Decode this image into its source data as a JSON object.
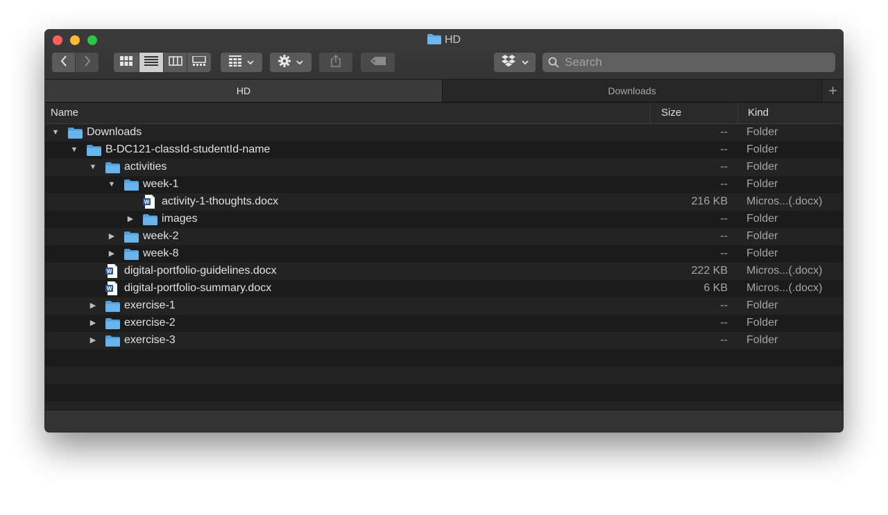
{
  "window": {
    "title": "HD"
  },
  "toolbar": {
    "back_icon": "chevron-left-icon",
    "forward_icon": "chevron-right-icon",
    "view_modes": [
      "icon-view-icon",
      "list-view-icon",
      "column-view-icon",
      "gallery-view-icon"
    ],
    "active_view": "list-view-icon",
    "group_icon": "group-grid-icon",
    "action_icon": "gear-icon",
    "share_icon": "share-icon",
    "tag_icon": "tag-icon",
    "dropbox_icon": "dropbox-icon",
    "search_placeholder": "Search"
  },
  "tabs": [
    {
      "label": "HD",
      "active": true
    },
    {
      "label": "Downloads",
      "active": false
    }
  ],
  "columns": {
    "name": "Name",
    "size": "Size",
    "kind": "Kind"
  },
  "rows": [
    {
      "name": "Downloads",
      "level": 0,
      "type": "folder",
      "expanded": true,
      "size": "--",
      "kind": "Folder"
    },
    {
      "name": "B-DC121-classId-studentId-name",
      "level": 1,
      "type": "folder",
      "expanded": true,
      "size": "--",
      "kind": "Folder"
    },
    {
      "name": "activities",
      "level": 2,
      "type": "folder",
      "expanded": true,
      "size": "--",
      "kind": "Folder"
    },
    {
      "name": "week-1",
      "level": 3,
      "type": "folder",
      "expanded": true,
      "size": "--",
      "kind": "Folder"
    },
    {
      "name": "activity-1-thoughts.docx",
      "level": 4,
      "type": "docx",
      "size": "216 KB",
      "kind": "Micros...(.docx)"
    },
    {
      "name": "images",
      "level": 4,
      "type": "folder",
      "expanded": false,
      "size": "--",
      "kind": "Folder"
    },
    {
      "name": "week-2",
      "level": 3,
      "type": "folder",
      "expanded": false,
      "size": "--",
      "kind": "Folder"
    },
    {
      "name": "week-8",
      "level": 3,
      "type": "folder",
      "expanded": false,
      "size": "--",
      "kind": "Folder"
    },
    {
      "name": "digital-portfolio-guidelines.docx",
      "level": 2,
      "type": "docx",
      "size": "222 KB",
      "kind": "Micros...(.docx)"
    },
    {
      "name": "digital-portfolio-summary.docx",
      "level": 2,
      "type": "docx",
      "size": "6 KB",
      "kind": "Micros...(.docx)"
    },
    {
      "name": "exercise-1",
      "level": 2,
      "type": "folder",
      "expanded": false,
      "size": "--",
      "kind": "Folder"
    },
    {
      "name": "exercise-2",
      "level": 2,
      "type": "folder",
      "expanded": false,
      "size": "--",
      "kind": "Folder"
    },
    {
      "name": "exercise-3",
      "level": 2,
      "type": "folder",
      "expanded": false,
      "size": "--",
      "kind": "Folder"
    }
  ],
  "colors": {
    "folder": "#5aa9e6",
    "window_bg": "#1f1f1f",
    "toolbar": "#383838"
  }
}
